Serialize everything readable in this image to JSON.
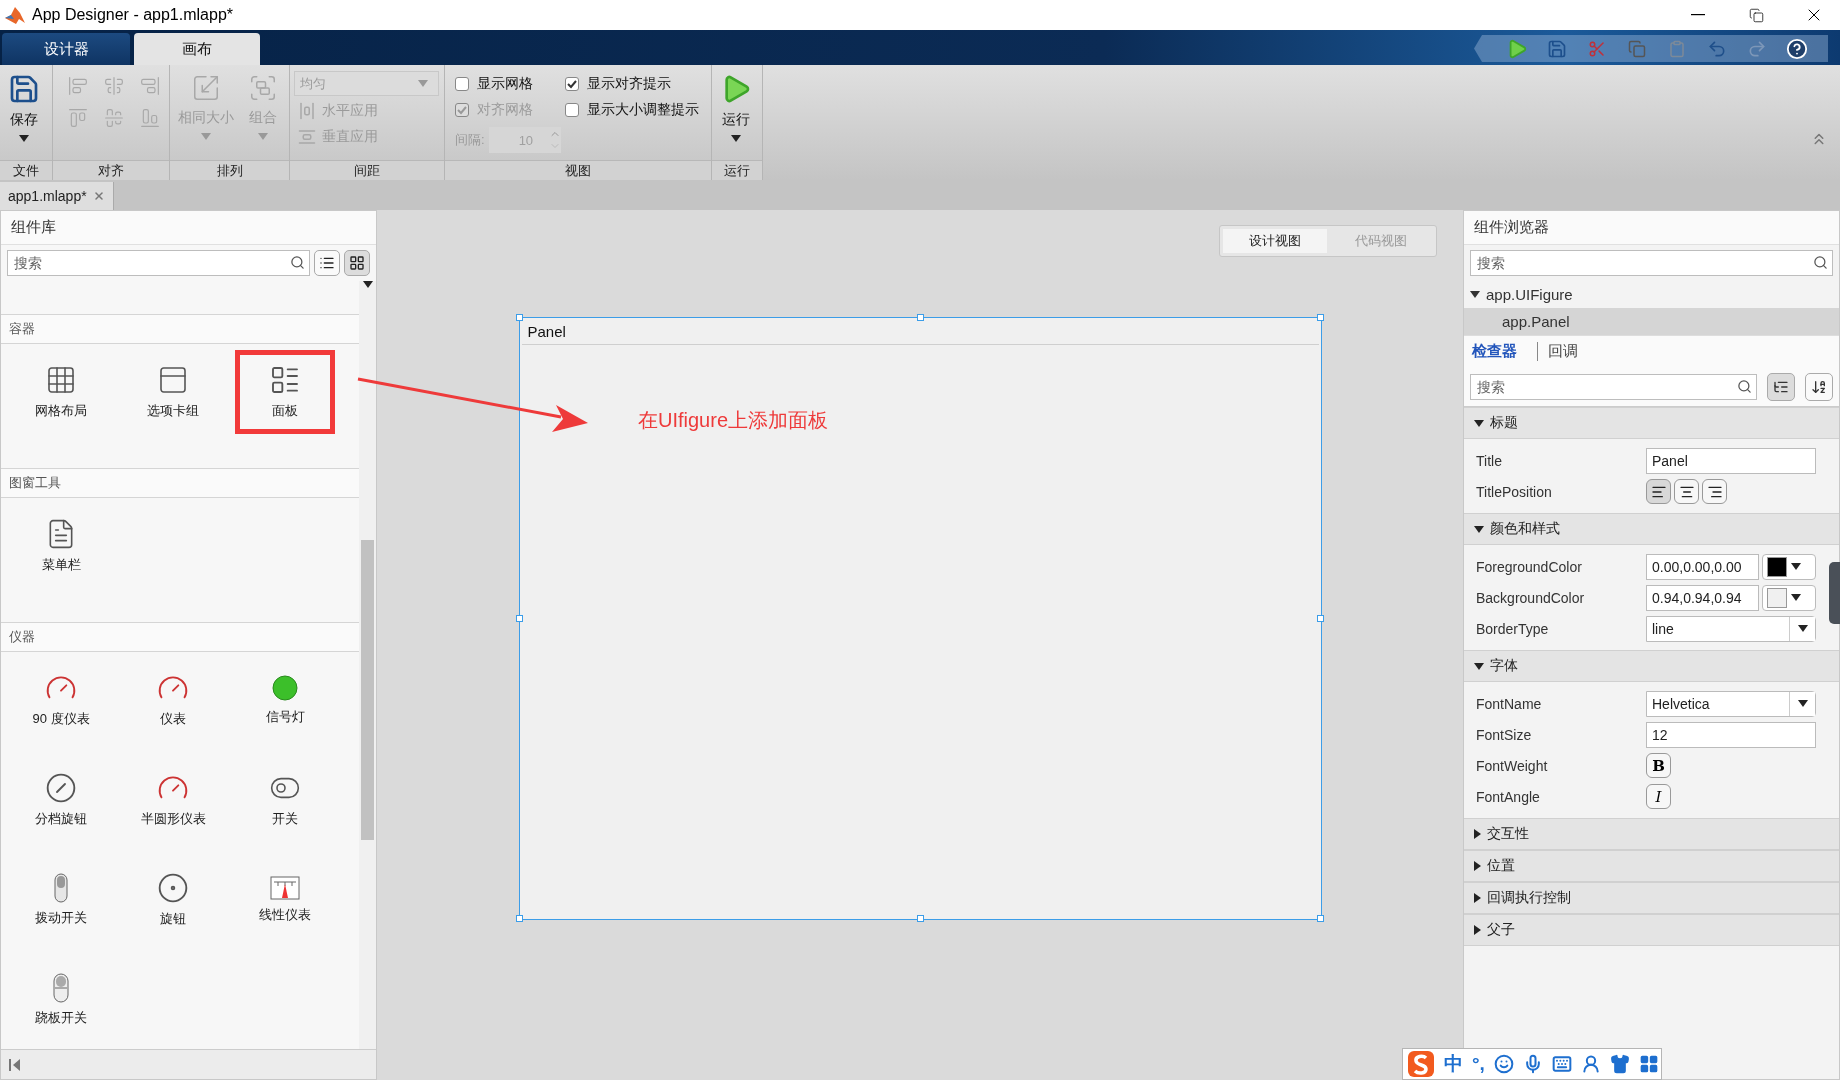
{
  "window": {
    "title": "App Designer - app1.mlapp*"
  },
  "ribbon_tabs": [
    {
      "label": "设计器",
      "selected": false
    },
    {
      "label": "画布",
      "selected": true
    }
  ],
  "ribbon": {
    "file_group": {
      "label": "文件",
      "save": "保存"
    },
    "align_group": {
      "label": "对齐",
      "disabled": true
    },
    "arrange_group": {
      "label": "排列",
      "disabled": true,
      "same_size": "相同大小",
      "group": "组合"
    },
    "spacing_group": {
      "label": "间距",
      "disabled": true,
      "mode": "均匀",
      "horizontal": "水平应用",
      "vertical": "垂直应用"
    },
    "view_group": {
      "label": "视图",
      "checkboxes": [
        {
          "label": "显示网格",
          "checked": false,
          "disabled": false
        },
        {
          "label": "显示对齐提示",
          "checked": true,
          "disabled": false
        },
        {
          "label": "对齐网格",
          "checked": true,
          "disabled": true
        },
        {
          "label": "显示大小调整提示",
          "checked": false,
          "disabled": false
        }
      ],
      "spacing_label": "间隔:",
      "spacing_value": "10",
      "spacing_disabled": true
    },
    "run_group": {
      "label": "运行",
      "run": "运行"
    }
  },
  "document_tabs": [
    {
      "label": "app1.mlapp*",
      "selected": true
    }
  ],
  "component_library": {
    "title": "组件库",
    "search_placeholder": "搜索",
    "view_modes": [
      {
        "kind": "list",
        "selected": false
      },
      {
        "kind": "grid",
        "selected": true
      }
    ],
    "sections": [
      {
        "title": "容器",
        "items": [
          {
            "label": "网格布局",
            "kind": "grid",
            "highlighted": false
          },
          {
            "label": "选项卡组",
            "kind": "tabs",
            "highlighted": false
          },
          {
            "label": "面板",
            "kind": "panel",
            "highlighted": true
          }
        ]
      },
      {
        "title": "图窗工具",
        "items": [
          {
            "label": "菜单栏",
            "kind": "menubar",
            "highlighted": false
          }
        ]
      },
      {
        "title": "仪器",
        "items": [
          {
            "label": "90 度仪表",
            "kind": "gauge90",
            "highlighted": false
          },
          {
            "label": "仪表",
            "kind": "gauge",
            "highlighted": false
          },
          {
            "label": "信号灯",
            "kind": "lamp",
            "highlighted": false
          },
          {
            "label": "分档旋钮",
            "kind": "discrete_knob",
            "highlighted": false
          },
          {
            "label": "半圆形仪表",
            "kind": "semicircle_gauge",
            "highlighted": false
          },
          {
            "label": "开关",
            "kind": "switch",
            "highlighted": false
          },
          {
            "label": "拨动开关",
            "kind": "toggle_switch",
            "highlighted": false
          },
          {
            "label": "旋钮",
            "kind": "knob",
            "highlighted": false
          },
          {
            "label": "线性仪表",
            "kind": "linear_gauge",
            "highlighted": false
          },
          {
            "label": "跷板开关",
            "kind": "rocker_switch",
            "highlighted": false
          }
        ]
      }
    ]
  },
  "canvas": {
    "view_toggle": [
      {
        "label": "设计视图",
        "selected": true
      },
      {
        "label": "代码视图",
        "selected": false
      }
    ],
    "panel": {
      "title": "Panel",
      "selected": true
    },
    "annotation": "在UIfigure上添加面板"
  },
  "component_browser": {
    "title": "组件浏览器",
    "search_placeholder": "搜索",
    "tree": [
      {
        "label": "app.UIFigure",
        "expanded": true,
        "selected": false,
        "children": [
          {
            "label": "app.Panel",
            "selected": true
          }
        ]
      }
    ]
  },
  "inspector": {
    "tabs": [
      {
        "label": "检查器",
        "selected": true
      },
      {
        "label": "回调",
        "selected": false
      }
    ],
    "search_placeholder": "搜索",
    "sections": [
      {
        "title": "标题",
        "expanded": true,
        "properties": [
          {
            "name": "Title",
            "kind": "text",
            "value": "Panel"
          },
          {
            "name": "TitlePosition",
            "kind": "align",
            "options": [
              {
                "kind": "left",
                "selected": true
              },
              {
                "kind": "center",
                "selected": false
              },
              {
                "kind": "right",
                "selected": false
              }
            ]
          }
        ]
      },
      {
        "title": "颜色和样式",
        "expanded": true,
        "properties": [
          {
            "name": "ForegroundColor",
            "kind": "color",
            "value": "0.00,0.00,0.00",
            "color": "#000000"
          },
          {
            "name": "BackgroundColor",
            "kind": "color",
            "value": "0.94,0.94,0.94",
            "color": "#f0f0f0"
          },
          {
            "name": "BorderType",
            "kind": "dropdown",
            "value": "line"
          }
        ]
      },
      {
        "title": "字体",
        "expanded": true,
        "properties": [
          {
            "name": "FontName",
            "kind": "dropdown",
            "value": "Helvetica"
          },
          {
            "name": "FontSize",
            "kind": "text",
            "value": "12"
          },
          {
            "name": "FontWeight",
            "kind": "bold_toggle",
            "symbol": "B",
            "on": false
          },
          {
            "name": "FontAngle",
            "kind": "italic_toggle",
            "symbol": "I",
            "on": false
          }
        ]
      },
      {
        "title": "交互性",
        "expanded": false
      },
      {
        "title": "位置",
        "expanded": false
      },
      {
        "title": "回调执行控制",
        "expanded": false
      },
      {
        "title": "父子",
        "expanded": false
      }
    ]
  },
  "ime_bar": {
    "mode": "中",
    "punctuation": "°,"
  }
}
